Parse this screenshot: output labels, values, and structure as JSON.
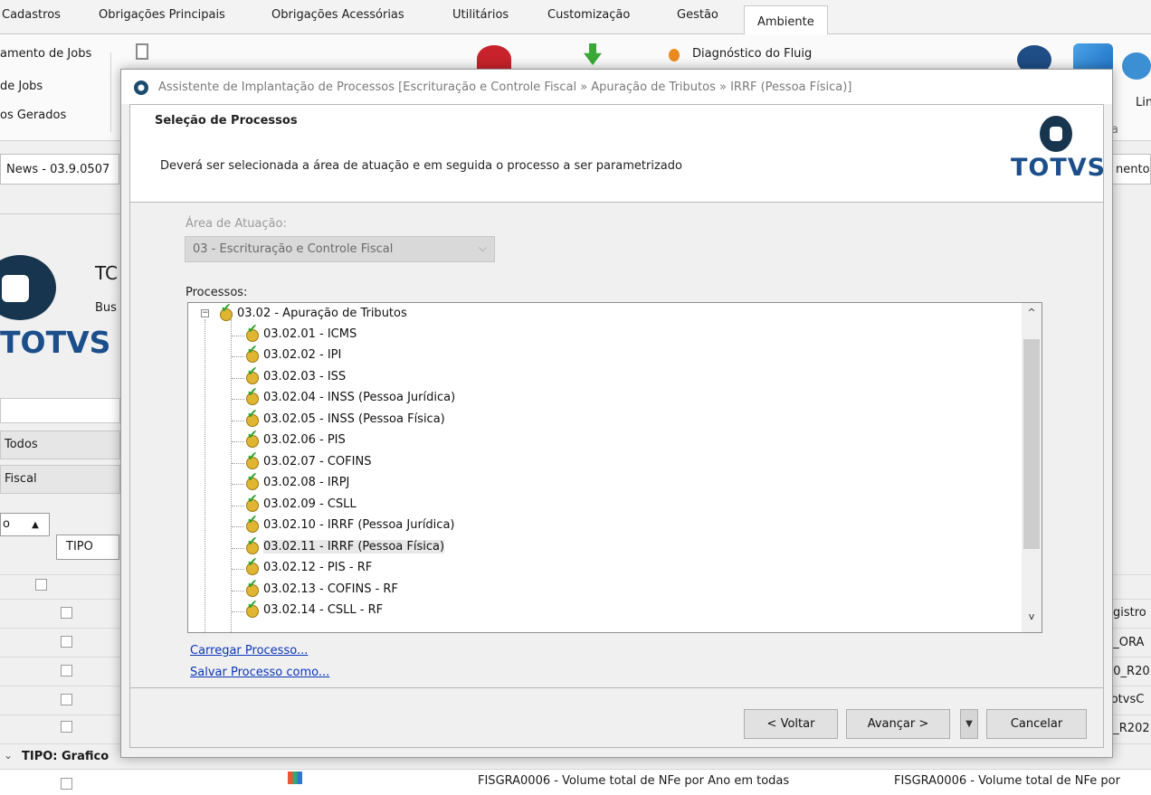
{
  "ribbon": {
    "tabs": [
      "Cadastros",
      "Obrigações Principais",
      "Obrigações Acessórias",
      "Utilitários",
      "Customização",
      "Gestão",
      "Ambiente"
    ],
    "items_left": [
      "amento de Jobs",
      "de Jobs",
      "os Gerados"
    ],
    "item_fluig": "Diagnóstico do Fluig",
    "item_right_1": "Lin",
    "item_right_2": "e",
    "item_right_3": "a"
  },
  "background": {
    "tab_left": "News - 03.9.0507",
    "tab_right": "nento -",
    "logo_text": "TOTVS",
    "app_title_partial": "TC",
    "app_sub_partial": "Bus",
    "btn_todos": "Todos",
    "btn_fiscal": "Fiscal",
    "sort_label": "o",
    "sort_caret": "▲",
    "tipo_label": "TIPO",
    "group_label": "TIPO: Grafico",
    "right_cells": [
      "egistro",
      "0_ORA",
      "30_R20",
      "TotvsC",
      "0_R202"
    ],
    "bottom_cell_1": "FISGRA0006 - Volume total de NFe por Ano em todas",
    "bottom_cell_2": "FISGRA0006 - Volume total de NFe por"
  },
  "dialog": {
    "title": "Assistente de Implantação de Processos [Escrituração e Controle Fiscal » Apuração de Tributos » IRRF (Pessoa Física)]",
    "header_title": "Seleção de Processos",
    "header_desc": "Deverá ser selecionada a área de atuação e em seguida o processo a ser parametrizado",
    "logo_text": "TOTVS",
    "area_label": "Área de Atuação:",
    "area_value": "03 - Escrituração e Controle Fiscal",
    "processes_label": "Processos:",
    "tree_root": "03.02 - Apuração de Tributos",
    "tree_items": [
      "03.02.01 - ICMS",
      "03.02.02 - IPI",
      "03.02.03 - ISS",
      "03.02.04 - INSS (Pessoa Jurídica)",
      "03.02.05 - INSS (Pessoa Física)",
      "03.02.06 - PIS",
      "03.02.07 - COFINS",
      "03.02.08 - IRPJ",
      "03.02.09 - CSLL",
      "03.02.10 - IRRF (Pessoa Jurídica)",
      "03.02.11 - IRRF (Pessoa Física)",
      "03.02.12 - PIS - RF",
      "03.02.13 - COFINS - RF",
      "03.02.14 - CSLL - RF"
    ],
    "selected_item": "03.02.11 - IRRF (Pessoa Física)",
    "link_load": "Carregar Processo...",
    "link_save": "Salvar Processo como...",
    "btn_back": "< Voltar",
    "btn_next": "Avançar >",
    "btn_cancel": "Cancelar"
  }
}
